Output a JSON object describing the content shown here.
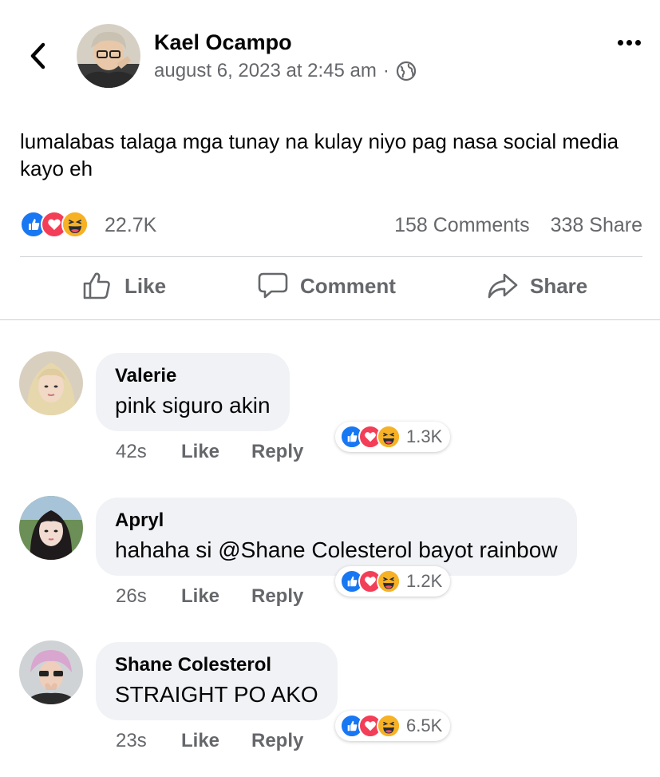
{
  "post": {
    "author": "Kael Ocampo",
    "timestamp": "august 6, 2023 at 2:45 am",
    "separator": "·",
    "text": "lumalabas talaga mga tunay na kulay niyo pag nasa social media kayo eh",
    "reaction_count": "22.7K",
    "comments_count": "158 Comments",
    "share_count": "338 Share"
  },
  "actions": {
    "like": "Like",
    "comment": "Comment",
    "share": "Share"
  },
  "comments": [
    {
      "name": "Valerie",
      "text": "pink siguro akin",
      "time": "42s",
      "like": "Like",
      "reply": "Reply",
      "reactions": "1.3K"
    },
    {
      "name": "Apryl",
      "text": "hahaha si @Shane Colesterol bayot rainbow",
      "time": "26s",
      "like": "Like",
      "reply": "Reply",
      "reactions": "1.2K"
    },
    {
      "name": "Shane Colesterol",
      "text": "STRAIGHT PO AKO",
      "time": "23s",
      "like": "Like",
      "reply": "Reply",
      "reactions": "6.5K"
    }
  ],
  "icons": {
    "back": "chevron-left-icon",
    "more": "more-dots-icon",
    "privacy": "globe-icon",
    "like": "thumbs-up-icon",
    "comment": "speech-bubble-icon",
    "share": "share-arrow-icon"
  },
  "colors": {
    "like": "#1877f2",
    "love": "#f33e58",
    "haha": "#f7b125",
    "secondary_text": "#65676b",
    "bubble": "#f0f2f5"
  }
}
